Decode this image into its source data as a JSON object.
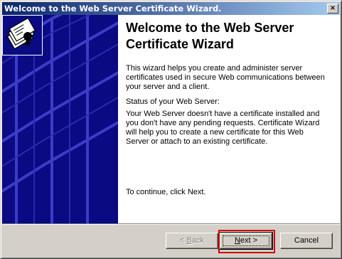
{
  "window": {
    "title": "Welcome to the Web Server Certificate Wizard.",
    "close_glyph": "×"
  },
  "main": {
    "heading": "Welcome to the Web Server Certificate Wizard",
    "intro": "This wizard helps you create and administer server certificates used in secure Web communications between your server and a client.",
    "status_label": "Status of your Web Server:",
    "status_text": "Your Web Server doesn't have a certificate installed and you don't have any pending requests. Certificate Wizard will help you to create a new certificate for this Web Server or attach to an existing certificate.",
    "continue_text": "To continue, click Next."
  },
  "buttons": {
    "back": {
      "label": "< Back",
      "accel": "B",
      "enabled": false
    },
    "next": {
      "label": "Next >",
      "accel": "N",
      "enabled": true,
      "highlighted": true
    },
    "cancel": {
      "label": "Cancel"
    }
  },
  "icons": {
    "wizard": "certificate-wizard-icon",
    "side": "wizard-banner-graphic"
  },
  "colors": {
    "side_panel": "#0a0a83",
    "titlebar_start": "#0a246a",
    "highlight": "#d00000"
  }
}
